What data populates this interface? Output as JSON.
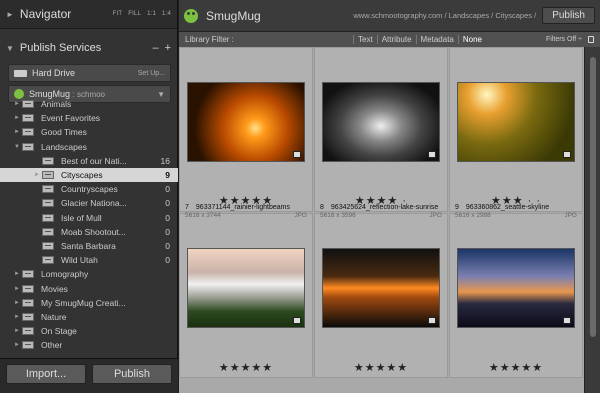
{
  "navigator": {
    "title": "Navigator",
    "opts": [
      "FIT",
      "FILL",
      "1:1",
      "1:4"
    ]
  },
  "publish_services": {
    "title": "Publish Services",
    "minus": "–",
    "plus": "+",
    "services": [
      {
        "name": "Hard Drive",
        "account": "",
        "action": "Set Up..."
      },
      {
        "name": "SmugMug",
        "account": ": schmoo",
        "action": "▼"
      }
    ]
  },
  "tree": [
    {
      "label": "Animals",
      "count": "",
      "level": 1,
      "expand": "►"
    },
    {
      "label": "Event Favorites",
      "count": "",
      "level": 1,
      "expand": "►"
    },
    {
      "label": "Good Times",
      "count": "",
      "level": 1,
      "expand": "►"
    },
    {
      "label": "Landscapes",
      "count": "",
      "level": 1,
      "expand": "▼"
    },
    {
      "label": "Best of our Nati...",
      "count": "16",
      "level": 2,
      "expand": ""
    },
    {
      "label": "Cityscapes",
      "count": "9",
      "level": 2,
      "expand": "►",
      "selected": true
    },
    {
      "label": "Countryscapes",
      "count": "0",
      "level": 2,
      "expand": ""
    },
    {
      "label": "Glacier Nationa...",
      "count": "0",
      "level": 2,
      "expand": ""
    },
    {
      "label": "Isle of Mull",
      "count": "0",
      "level": 2,
      "expand": ""
    },
    {
      "label": "Moab Shootout...",
      "count": "0",
      "level": 2,
      "expand": ""
    },
    {
      "label": "Santa Barbara",
      "count": "0",
      "level": 2,
      "expand": ""
    },
    {
      "label": "Wild Utah",
      "count": "0",
      "level": 2,
      "expand": ""
    },
    {
      "label": "Lomography",
      "count": "",
      "level": 1,
      "expand": "►"
    },
    {
      "label": "Movies",
      "count": "",
      "level": 1,
      "expand": "►"
    },
    {
      "label": "My SmugMug Creati...",
      "count": "",
      "level": 1,
      "expand": "►"
    },
    {
      "label": "Nature",
      "count": "",
      "level": 1,
      "expand": "►"
    },
    {
      "label": "On Stage",
      "count": "",
      "level": 1,
      "expand": "►"
    },
    {
      "label": "Other",
      "count": "",
      "level": 1,
      "expand": "►"
    }
  ],
  "buttons": {
    "import": "Import...",
    "publish": "Publish"
  },
  "top": {
    "title": "SmugMug",
    "path": "www.schmootography.com / Landscapes / Cityscapes /",
    "publish": "Publish"
  },
  "filter": {
    "label": "Library Filter :",
    "options": [
      "Text",
      "Attribute",
      "Metadata",
      "None"
    ],
    "active": "None",
    "filters_off": "Filters Off ÷"
  },
  "photos": [
    {
      "num": "",
      "name": "",
      "dims": "",
      "ext": "",
      "rating": "★★★★★"
    },
    {
      "num": "",
      "name": "",
      "dims": "",
      "ext": "",
      "rating": "★★★★ ·"
    },
    {
      "num": "",
      "name": "",
      "dims": "",
      "ext": "",
      "rating": "★★★ · ·"
    },
    {
      "num": "7",
      "name": "963371144_rainier-lightbeams",
      "dims": "5616 x 3744",
      "ext": "JPG",
      "rating": "★★★★★"
    },
    {
      "num": "8",
      "name": "963425624_reflection-lake-sunrise",
      "dims": "5616 x 3596",
      "ext": "JPG",
      "rating": "★★★★★"
    },
    {
      "num": "9",
      "name": "963360862_seattle-skyline",
      "dims": "5616 x 2988",
      "ext": "JPG",
      "rating": "★★★★★"
    }
  ]
}
